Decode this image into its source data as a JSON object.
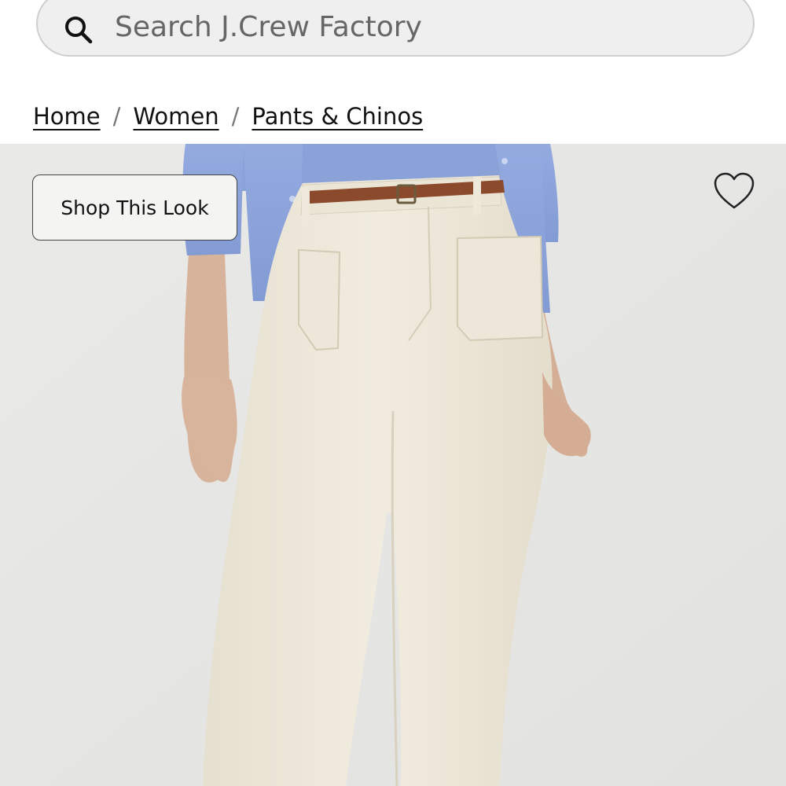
{
  "search": {
    "placeholder": "Search J.Crew Factory",
    "icon": "search-icon"
  },
  "breadcrumb": {
    "items": [
      {
        "label": "Home"
      },
      {
        "label": "Women"
      },
      {
        "label": "Pants & Chinos"
      }
    ],
    "separator": "/"
  },
  "product_image": {
    "description_icon": "product-photo",
    "shop_look_label": "Shop This Look",
    "wishlist_icon": "heart-outline-icon"
  },
  "colors": {
    "background": "#ffffff",
    "hero_background": "#e7e7e5",
    "cardigan": "#8fa6dc",
    "pants": "#efeadd",
    "belt": "#8b4a2b",
    "skin": "#d9b59d"
  }
}
